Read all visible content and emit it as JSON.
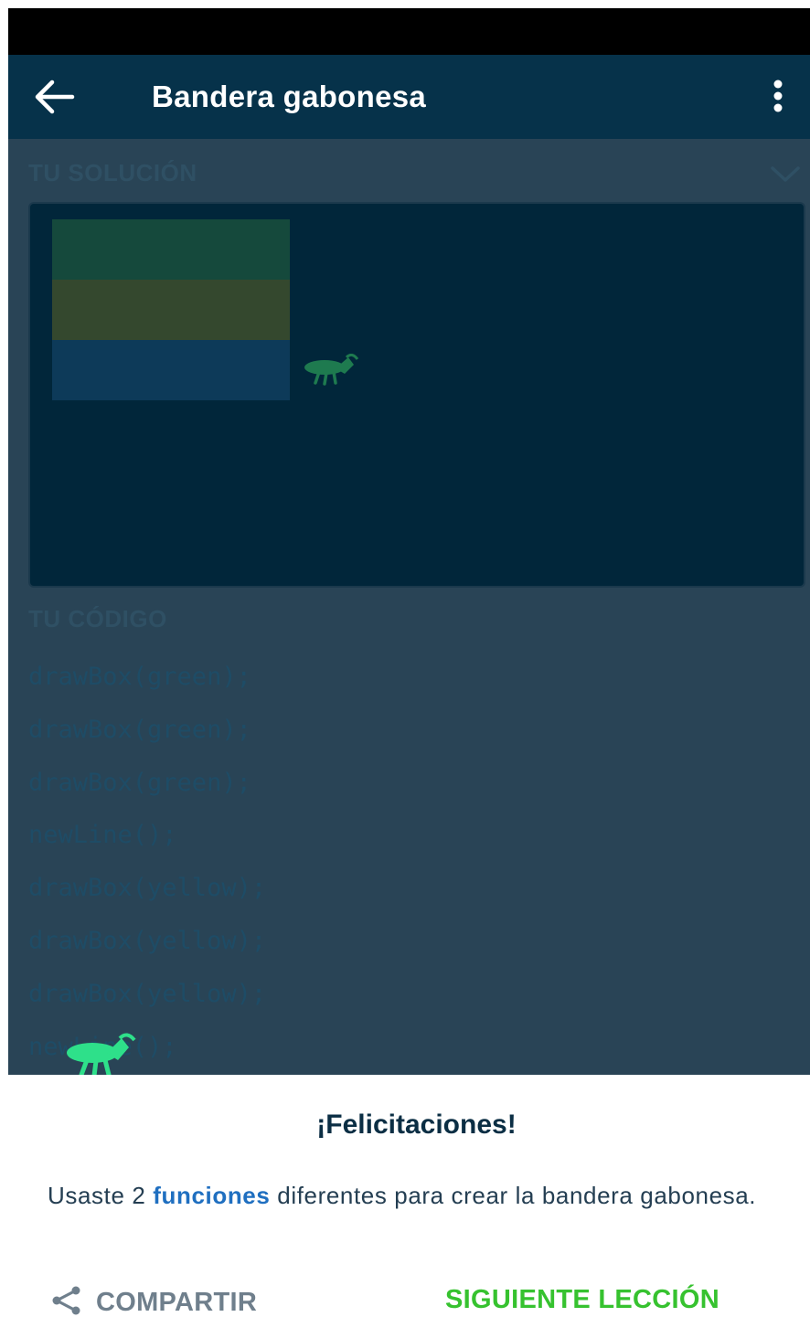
{
  "app_bar": {
    "title": "Bandera gabonesa",
    "back_icon": "arrow-left-icon",
    "menu_icon": "more-vertical-icon"
  },
  "solution_section": {
    "label": "TU SOLUCIÓN",
    "collapse_icon": "chevron-down-icon",
    "flag_stripes": [
      {
        "color_name": "green",
        "hex": "#15493c"
      },
      {
        "color_name": "yellow",
        "hex": "#34482e"
      },
      {
        "color_name": "blue",
        "hex": "#0d3a59"
      }
    ],
    "mascot_icon": "grasshopper-icon"
  },
  "code_section": {
    "label": "TU CÓDIGO",
    "lines": [
      "drawBox(green);",
      "drawBox(green);",
      "drawBox(green);",
      "newLine();",
      "drawBox(yellow);",
      "drawBox(yellow);",
      "drawBox(yellow);",
      "newLine();"
    ]
  },
  "result_sheet": {
    "title": "¡Felicitaciones!",
    "message_before": "Usaste 2 ",
    "message_link": "funciones",
    "message_after": " diferentes para crear la bandera gabonesa.",
    "share_label": "COMPARTIR",
    "share_icon": "share-icon",
    "next_label": "SIGUIENTE LECCIÓN"
  },
  "colors": {
    "app_bar": "#06324a",
    "overlay_background": "#294456",
    "accent_green": "#36c22f",
    "link_blue": "#1f6fc0",
    "mascot_green": "#2ee08a"
  }
}
